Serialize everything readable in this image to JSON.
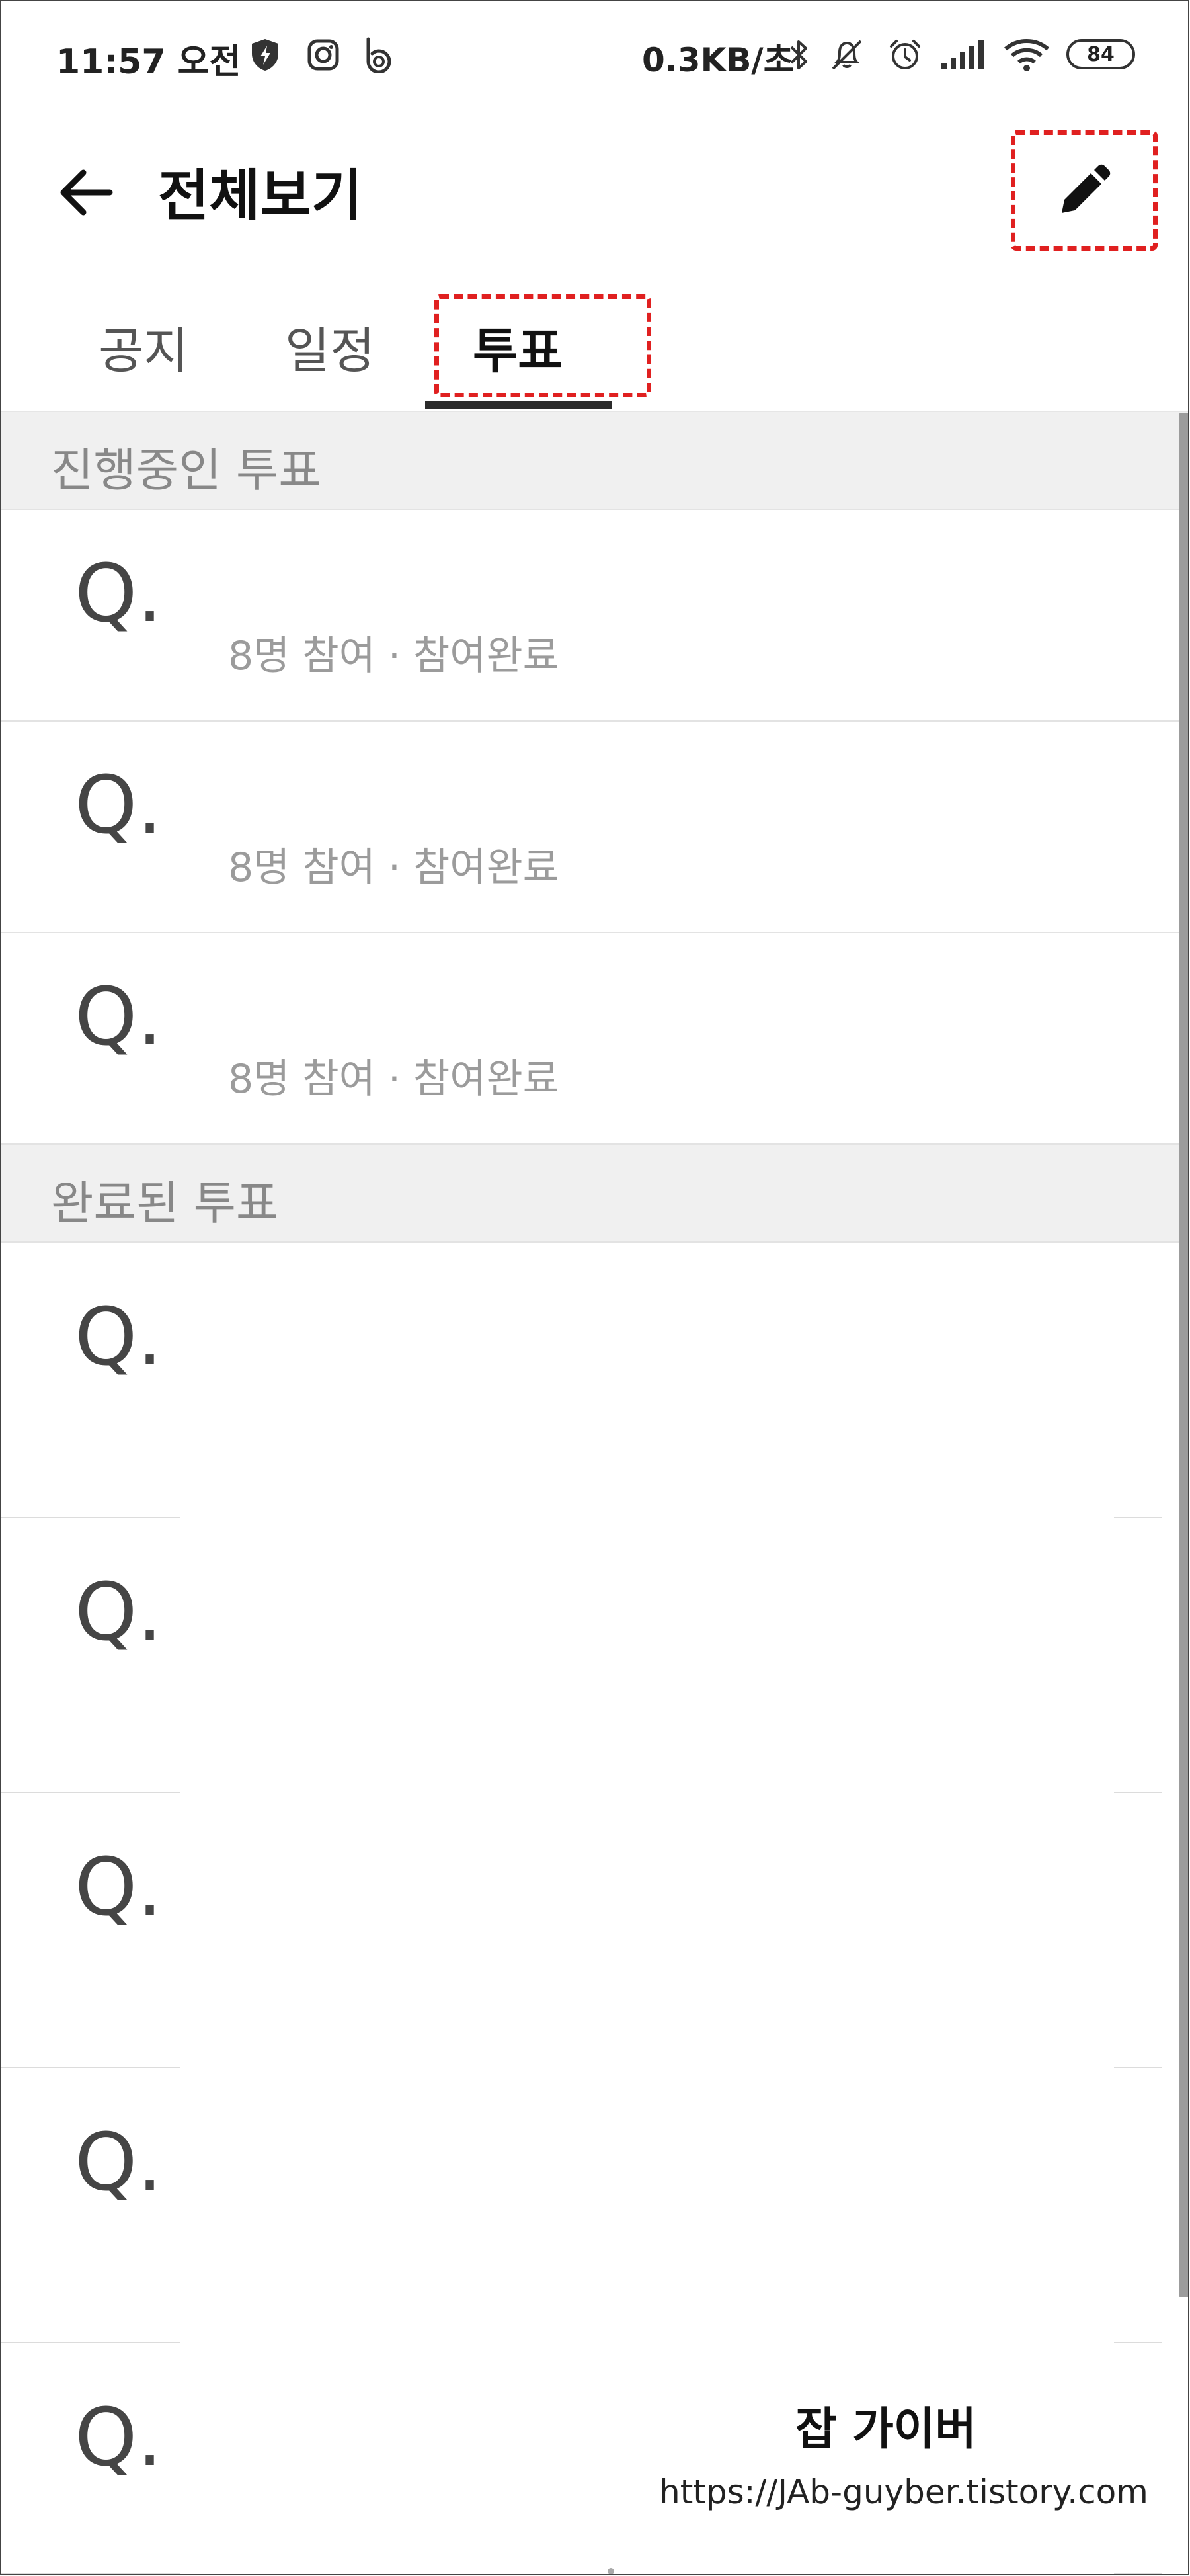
{
  "status_bar": {
    "time": "11:57 오전",
    "network_speed": "0.3KB/초",
    "battery_level": "84",
    "icons": [
      "shield-bolt-icon",
      "instagram-icon",
      "b-app-icon",
      "bluetooth-icon",
      "mute-icon",
      "alarm-icon",
      "signal-icon",
      "wifi-icon",
      "battery-icon"
    ]
  },
  "header": {
    "title": "전체보기",
    "back_icon": "arrow-left-icon",
    "edit_icon": "pencil-icon"
  },
  "tabs": [
    {
      "label": "공지",
      "active": false
    },
    {
      "label": "일정",
      "active": false
    },
    {
      "label": "투표",
      "active": true
    }
  ],
  "sections": {
    "ongoing": {
      "title": "진행중인 투표",
      "items": [
        {
          "q": "Q.",
          "meta": "8명 참여 · 참여완료"
        },
        {
          "q": "Q.",
          "meta": "8명 참여 · 참여완료"
        },
        {
          "q": "Q.",
          "meta": "8명 참여 · 참여완료"
        }
      ]
    },
    "completed": {
      "title": "완료된 투표",
      "items": [
        {
          "q": "Q."
        },
        {
          "q": "Q."
        },
        {
          "q": "Q."
        },
        {
          "q": "Q."
        },
        {
          "q": "Q."
        }
      ]
    }
  },
  "watermark": {
    "title": "잡 가이버",
    "url": "https://JAb-guyber.tistory.com"
  },
  "colors": {
    "highlight": "#e02020",
    "section_bg": "#f0f0f0",
    "meta_text": "#9b9b9b"
  }
}
